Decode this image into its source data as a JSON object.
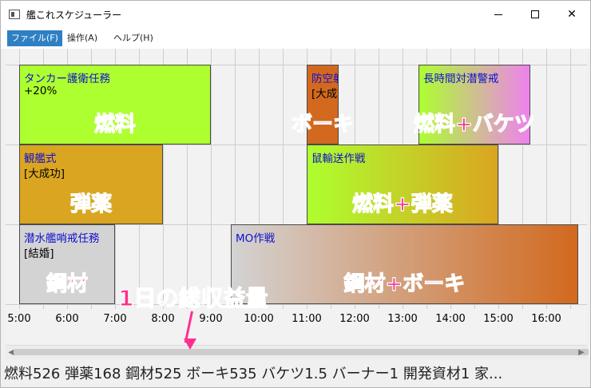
{
  "window": {
    "title": "艦これスケジューラー",
    "controls": {
      "minimize": "minimize-icon",
      "maximize": "maximize-icon",
      "close": "✕"
    }
  },
  "menu": [
    {
      "label": "ファイル(F)",
      "active": true
    },
    {
      "label": "操作(A)",
      "active": false
    },
    {
      "label": "ヘルプ(H)",
      "active": false
    }
  ],
  "timeline": {
    "ticks": [
      "5:00",
      "6:00",
      "7:00",
      "8:00",
      "9:00",
      "10:00",
      "11:00",
      "12:00",
      "13:00",
      "14:00",
      "15:00",
      "16:00"
    ],
    "expeditions": [
      {
        "name": "タンカー護衛任務",
        "sub": "+20%",
        "resource": "燃料",
        "start": "5:00",
        "end": "9:00",
        "lane": 1,
        "colors": [
          "#adff2f",
          "#adff2f"
        ]
      },
      {
        "name": "防空射撃演習",
        "sub": "[大成功]",
        "resource": "ボーキ",
        "start": "11:00",
        "end": "11:40",
        "lane": 1,
        "colors": [
          "#d2691e",
          "#d2691e"
        ]
      },
      {
        "name": "長時間対潜警戒",
        "sub": "",
        "resource": "燃料+バケツ",
        "start": "13:20",
        "end": "15:40",
        "lane": 1,
        "colors": [
          "#adff2f",
          "#ee82ee"
        ]
      },
      {
        "name": "観艦式",
        "sub": "[大成功]",
        "resource": "弾薬",
        "start": "5:00",
        "end": "8:00",
        "lane": 2,
        "colors": [
          "#daa520",
          "#daa520"
        ]
      },
      {
        "name": "鼠輸送作戦",
        "sub": "",
        "resource": "燃料+弾薬",
        "start": "11:00",
        "end": "15:00",
        "lane": 2,
        "colors": [
          "#adff2f",
          "#daa520"
        ]
      },
      {
        "name": "潜水艦哨戒任務",
        "sub": "[結婚]",
        "resource": "鋼材",
        "start": "5:00",
        "end": "7:00",
        "lane": 3,
        "colors": [
          "#d3d3d3",
          "#d3d3d3"
        ]
      },
      {
        "name": "MO作戦",
        "sub": "",
        "resource": "鋼材+ボーキ",
        "start": "9:25",
        "end": "16:40",
        "lane": 3,
        "colors": [
          "#d3d3d3",
          "#d2691e"
        ]
      }
    ]
  },
  "annotation": {
    "label": "1日の総収益量"
  },
  "status": "燃料526 弾薬168 鋼材525 ボーキ535 バケツ1.5 バーナー1 開発資材1 家..."
}
